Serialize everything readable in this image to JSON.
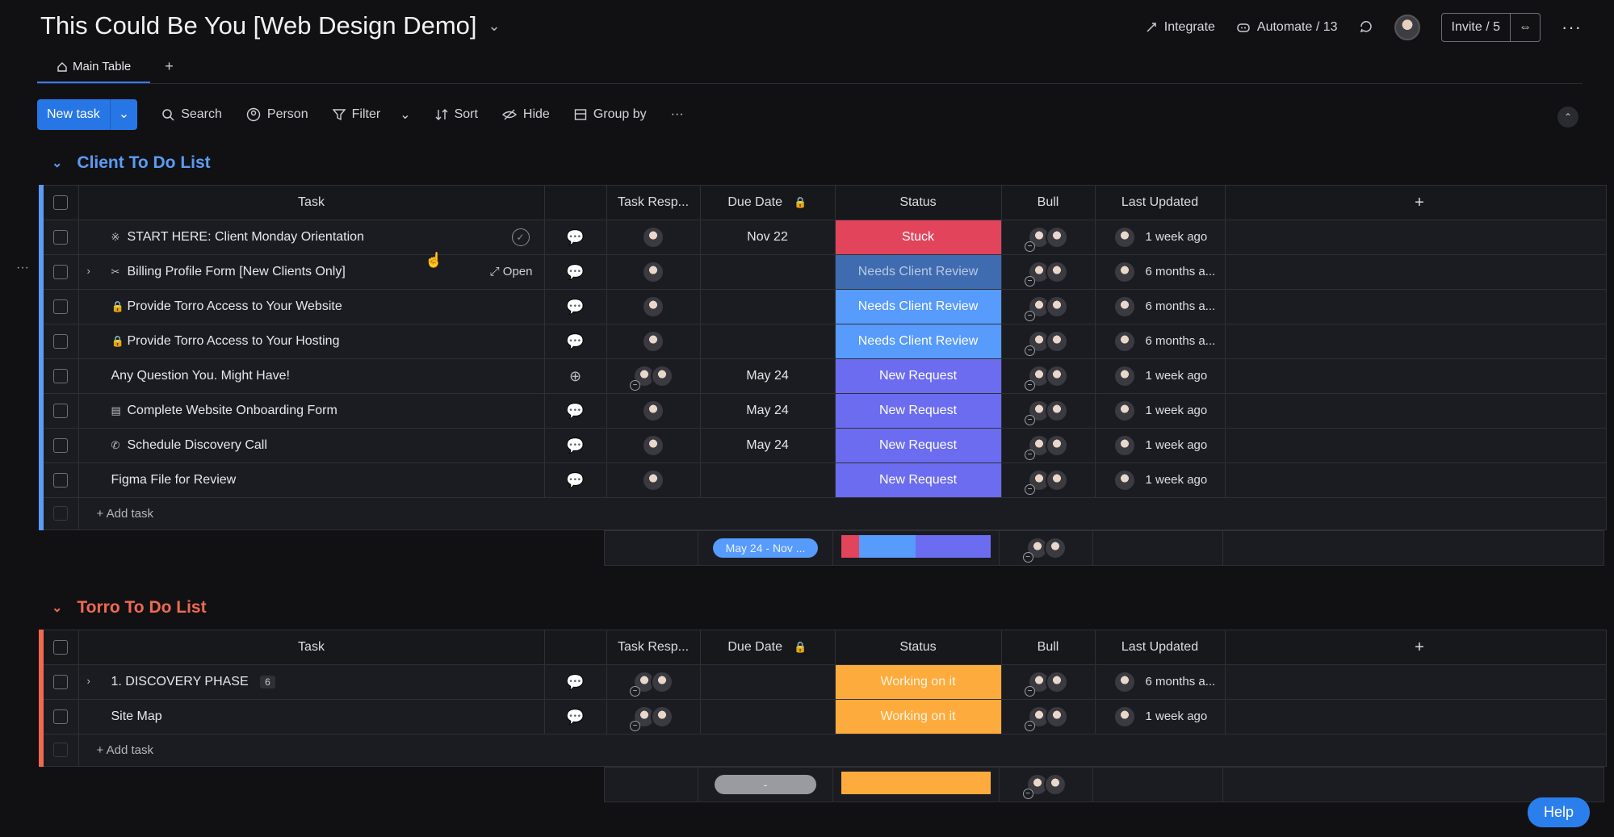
{
  "board": {
    "title": "This Could Be You [Web Design Demo]",
    "title_chevron": "⌄"
  },
  "top_actions": {
    "integrate": "Integrate",
    "automate": "Automate / 13",
    "invite": "Invite / 5"
  },
  "tabs": {
    "main": "Main Table",
    "add": "+"
  },
  "toolbar": {
    "new_task": "New task",
    "search": "Search",
    "person": "Person",
    "filter": "Filter",
    "sort": "Sort",
    "hide": "Hide",
    "group_by": "Group by",
    "more": "···"
  },
  "columns": {
    "task": "Task",
    "task_resp": "Task Resp...",
    "due_date": "Due Date",
    "status": "Status",
    "bull": "Bull",
    "last_updated": "Last Updated"
  },
  "groups": {
    "client": {
      "title": "Client To Do List",
      "color": "#5b9cf5",
      "rows": [
        {
          "task": "START HERE: Client Monday Orientation",
          "prefix": "※",
          "due": "Nov 22",
          "status": "Stuck",
          "updated": "1 week ago"
        },
        {
          "task": "Billing Profile Form [New Clients Only]",
          "prefix": "✂",
          "due": "",
          "status": "Needs Client Review",
          "updated": "6 months a...",
          "open": "Open"
        },
        {
          "task": "Provide Torro Access to Your Website",
          "prefix": "🔒",
          "due": "",
          "status": "Needs Client Review",
          "updated": "6 months a..."
        },
        {
          "task": "Provide Torro Access to Your Hosting",
          "prefix": "🔒",
          "due": "",
          "status": "Needs Client Review",
          "updated": "6 months a..."
        },
        {
          "task": "Any Question You. Might Have!",
          "prefix": "",
          "due": "May 24",
          "status": "New Request",
          "updated": "1 week ago"
        },
        {
          "task": "Complete Website Onboarding Form",
          "prefix": "▤",
          "due": "May 24",
          "status": "New Request",
          "updated": "1 week ago"
        },
        {
          "task": "Schedule Discovery Call",
          "prefix": "✆",
          "due": "May 24",
          "status": "New Request",
          "updated": "1 week ago"
        },
        {
          "task": "Figma File for Review",
          "prefix": "",
          "due": "",
          "status": "New Request",
          "updated": "1 week ago"
        }
      ],
      "add_task": "+ Add task",
      "summary_dates": "May 24 - Nov ..."
    },
    "torro": {
      "title": "Torro To Do List",
      "color": "#f06a4f",
      "rows": [
        {
          "task": "1. DISCOVERY PHASE",
          "count": "6",
          "due": "",
          "status": "Working on it",
          "updated": "6 months a..."
        },
        {
          "task": "Site Map",
          "due": "",
          "status": "Working on it",
          "updated": "1 week ago"
        }
      ],
      "add_task": "+ Add task",
      "summary_dates": "-"
    }
  },
  "help": "Help",
  "colors": {
    "stuck": "#e2445c",
    "needs_review": "#579bfc",
    "new_request": "#6c6cf0",
    "working": "#fdab3d",
    "accent": "#2776e6"
  }
}
